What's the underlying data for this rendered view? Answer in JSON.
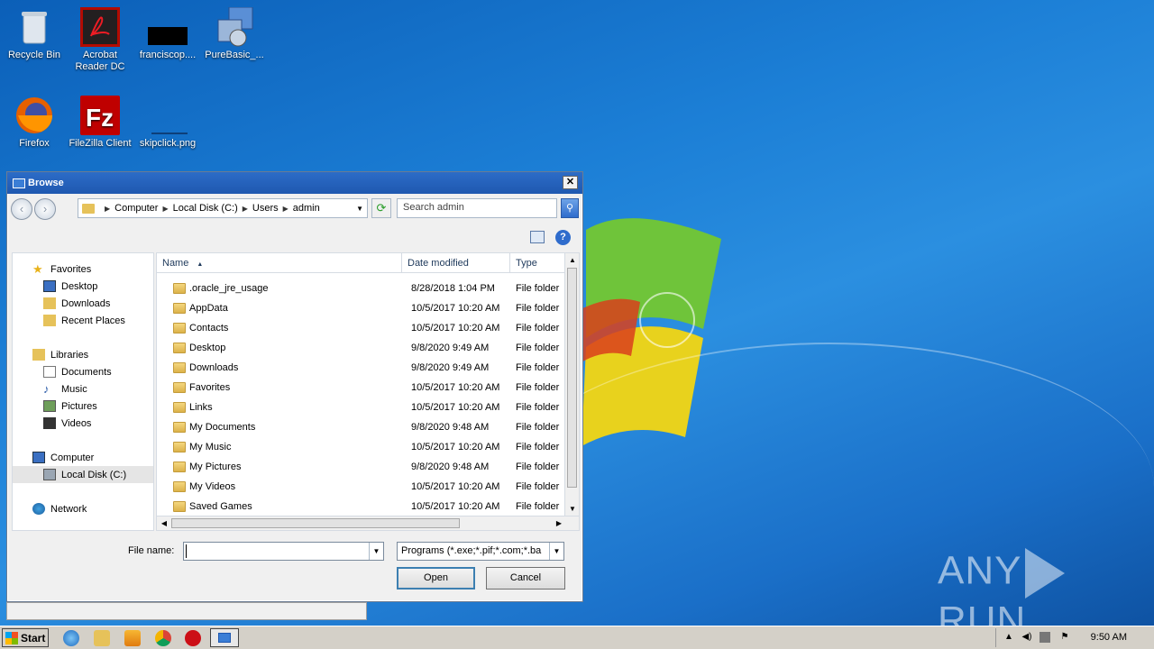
{
  "desktop": {
    "icons": [
      {
        "label": "Recycle Bin"
      },
      {
        "label": "Acrobat Reader DC"
      },
      {
        "label": "franciscop...."
      },
      {
        "label": "PureBasic_..."
      },
      {
        "label": "Firefox"
      },
      {
        "label": "FileZilla Client"
      },
      {
        "label": "skipclick.png"
      }
    ],
    "watermark": {
      "left": "ANY",
      "right": "RUN"
    }
  },
  "dialog": {
    "title": "Browse",
    "close_label": "✕",
    "breadcrumb": [
      "Computer",
      "Local Disk (C:)",
      "Users",
      "admin"
    ],
    "search_placeholder": "Search admin",
    "help_label": "?",
    "nav": {
      "favorites": {
        "label": "Favorites",
        "items": [
          "Desktop",
          "Downloads",
          "Recent Places"
        ]
      },
      "libraries": {
        "label": "Libraries",
        "items": [
          "Documents",
          "Music",
          "Pictures",
          "Videos"
        ]
      },
      "computer": {
        "label": "Computer",
        "items": [
          "Local Disk (C:)"
        ]
      },
      "network": {
        "label": "Network"
      }
    },
    "columns": {
      "name": "Name",
      "date": "Date modified",
      "type": "Type"
    },
    "files": [
      {
        "name": ".oracle_jre_usage",
        "date": "8/28/2018 1:04 PM",
        "type": "File folder"
      },
      {
        "name": "AppData",
        "date": "10/5/2017 10:20 AM",
        "type": "File folder"
      },
      {
        "name": "Contacts",
        "date": "10/5/2017 10:20 AM",
        "type": "File folder"
      },
      {
        "name": "Desktop",
        "date": "9/8/2020 9:49 AM",
        "type": "File folder"
      },
      {
        "name": "Downloads",
        "date": "9/8/2020 9:49 AM",
        "type": "File folder"
      },
      {
        "name": "Favorites",
        "date": "10/5/2017 10:20 AM",
        "type": "File folder"
      },
      {
        "name": "Links",
        "date": "10/5/2017 10:20 AM",
        "type": "File folder"
      },
      {
        "name": "My Documents",
        "date": "9/8/2020 9:48 AM",
        "type": "File folder"
      },
      {
        "name": "My Music",
        "date": "10/5/2017 10:20 AM",
        "type": "File folder"
      },
      {
        "name": "My Pictures",
        "date": "9/8/2020 9:48 AM",
        "type": "File folder"
      },
      {
        "name": "My Videos",
        "date": "10/5/2017 10:20 AM",
        "type": "File folder"
      },
      {
        "name": "Saved Games",
        "date": "10/5/2017 10:20 AM",
        "type": "File folder"
      }
    ],
    "filename_label": "File name:",
    "filename_value": "",
    "filetype_value": "Programs (*.exe;*.pif;*.com;*.ba",
    "open_label": "Open",
    "cancel_label": "Cancel"
  },
  "taskbar": {
    "start_label": "Start",
    "clock": "9:50 AM"
  }
}
